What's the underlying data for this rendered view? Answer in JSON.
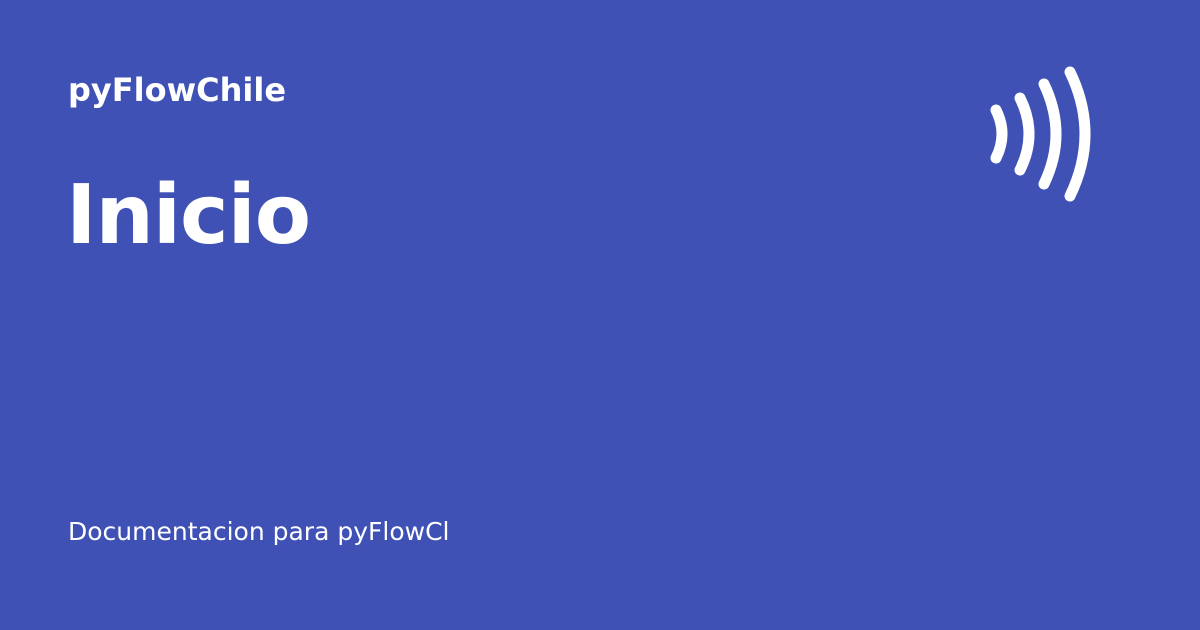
{
  "card": {
    "site_name": "pyFlowChile",
    "page_title": "Inicio",
    "description": "Documentacion para pyFlowCl",
    "logo_icon": "broadcast-waves-icon",
    "background_color": "#3F51B5",
    "text_color": "#FFFFFF"
  }
}
